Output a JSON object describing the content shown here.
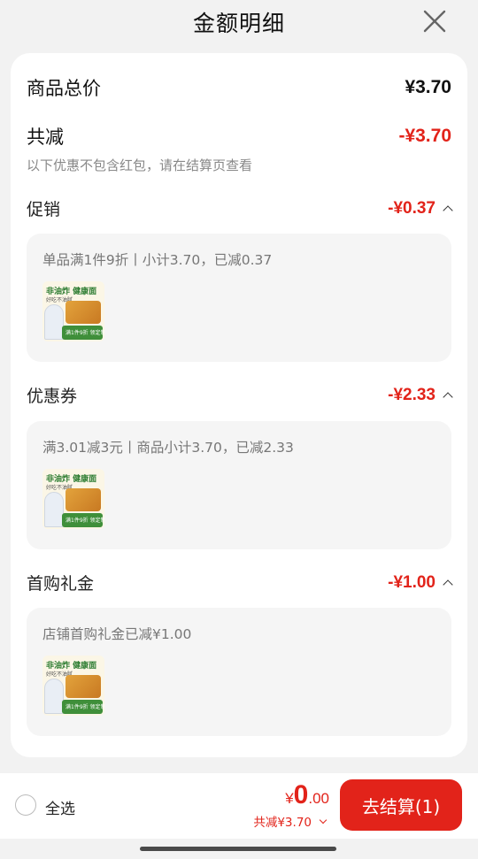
{
  "header": {
    "title": "金额明细"
  },
  "summary": {
    "goods_total_label": "商品总价",
    "goods_total_value": "¥3.70",
    "discount_label": "共减",
    "discount_value": "-¥3.70",
    "note": "以下优惠不包含红包，请在结算页查看"
  },
  "sections": [
    {
      "label": "促销",
      "amount": "-¥0.37",
      "desc": "单品满1件9折丨小计3.70，已减0.37"
    },
    {
      "label": "优惠券",
      "amount": "-¥2.33",
      "desc": "满3.01减3元丨商品小计3.70，已减2.33"
    },
    {
      "label": "首购礼金",
      "amount": "-¥1.00",
      "desc": "店铺首购礼金已减¥1.00"
    }
  ],
  "thumb": {
    "title": "非油炸 健康面",
    "sub": "好吃不油腻",
    "badge": "满1件9折 领定制手包"
  },
  "bottom": {
    "select_all": "全选",
    "currency": "¥",
    "total_int": "0",
    "total_dec": ".00",
    "discount_text": "共减¥3.70",
    "checkout_label": "去结算(1)"
  },
  "colors": {
    "accent": "#e2231a",
    "background": "#f2f2f2",
    "card": "#ffffff"
  }
}
